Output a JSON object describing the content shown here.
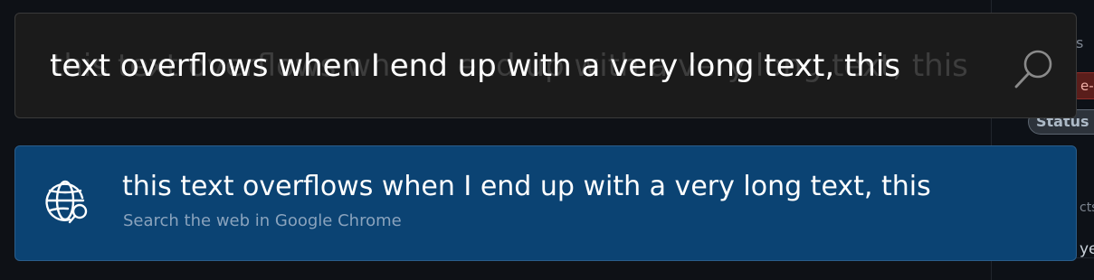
{
  "search": {
    "query": "text overflows when I end up with a very long text, this",
    "ghost_text": "this text overflows when I end up with a very long text, this"
  },
  "result": {
    "title": "this text overflows when I end up with a very long text, this",
    "subtitle": "Search the web in Google Chrome",
    "icon": "globe-search-icon"
  },
  "background_app": {
    "fragment_s": "s",
    "label_fragment": "e-l",
    "status_fragment": "Status",
    "fragment_cts": "cts",
    "fragment_ye": "ye"
  },
  "colors": {
    "search_box_bg": "#1b1b1b",
    "result_bg": "#0b4373",
    "text": "#ffffff",
    "subtitle": "#8aa3bd"
  }
}
